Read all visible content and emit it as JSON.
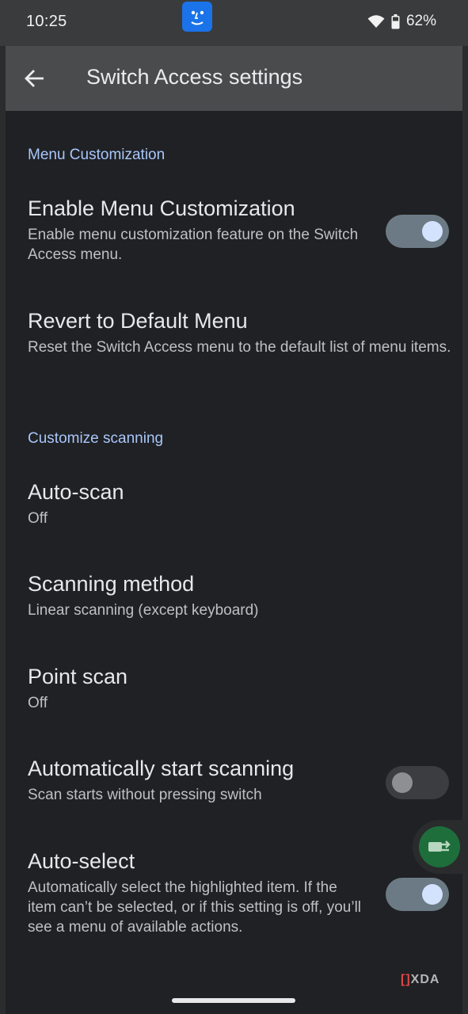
{
  "status_bar": {
    "time": "10:25",
    "battery": "62%"
  },
  "app_bar": {
    "title": "Switch Access settings"
  },
  "sections": {
    "menu_customization": "Menu Customization",
    "customize_scanning": "Customize scanning"
  },
  "prefs": {
    "enable_menu": {
      "title": "Enable Menu Customization",
      "summary": "Enable menu customization feature on the Switch Access menu.",
      "switch_on": true
    },
    "revert_menu": {
      "title": "Revert to Default Menu",
      "summary": "Reset the Switch Access menu to the default list of menu items."
    },
    "auto_scan": {
      "title": "Auto-scan",
      "summary": "Off"
    },
    "scanning_method": {
      "title": "Scanning method",
      "summary": "Linear scanning (except keyboard)"
    },
    "point_scan": {
      "title": "Point scan",
      "summary": "Off"
    },
    "auto_start": {
      "title": "Automatically start scanning",
      "summary": "Scan starts without pressing switch",
      "switch_on": false
    },
    "auto_select": {
      "title": "Auto-select",
      "summary": "Automatically select the highlighted item. If the item can’t be selected, or if this setting is off, you’ll see a menu of available actions.",
      "switch_on": true
    }
  },
  "watermark": {
    "text": "XDA"
  },
  "icons": {
    "back": "arrow-back-icon",
    "wifi": "wifi-icon",
    "battery": "battery-icon",
    "app": "face-app-icon",
    "float": "switch-access-float-icon"
  },
  "colors": {
    "accent": "#a8c7fa",
    "switch_on_track": "#6c7a85",
    "switch_on_thumb": "#d3e3fd"
  }
}
